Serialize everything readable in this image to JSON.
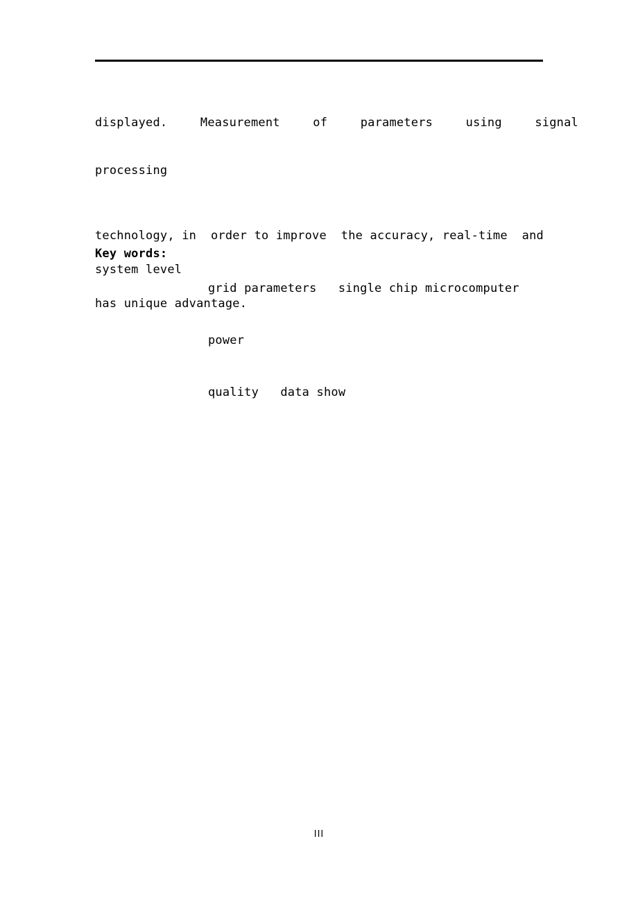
{
  "document": {
    "page_number": "III",
    "text_color": "#000000",
    "background_color": "#ffffff",
    "rule_color": "#000000"
  },
  "abstract": {
    "paragraph_1": {
      "line_1": "displayed.   Measurement   of   parameters   using   signal",
      "line_2": "processing"
    },
    "paragraph_2": "technology, in  order to improve  the accuracy, real-time  and",
    "paragraph_3": "system level",
    "paragraph_4": "has unique advantage."
  },
  "keywords": {
    "label": "Key words:",
    "lines": [
      "grid parameters   single chip microcomputer",
      "power",
      "quality   data show"
    ]
  }
}
